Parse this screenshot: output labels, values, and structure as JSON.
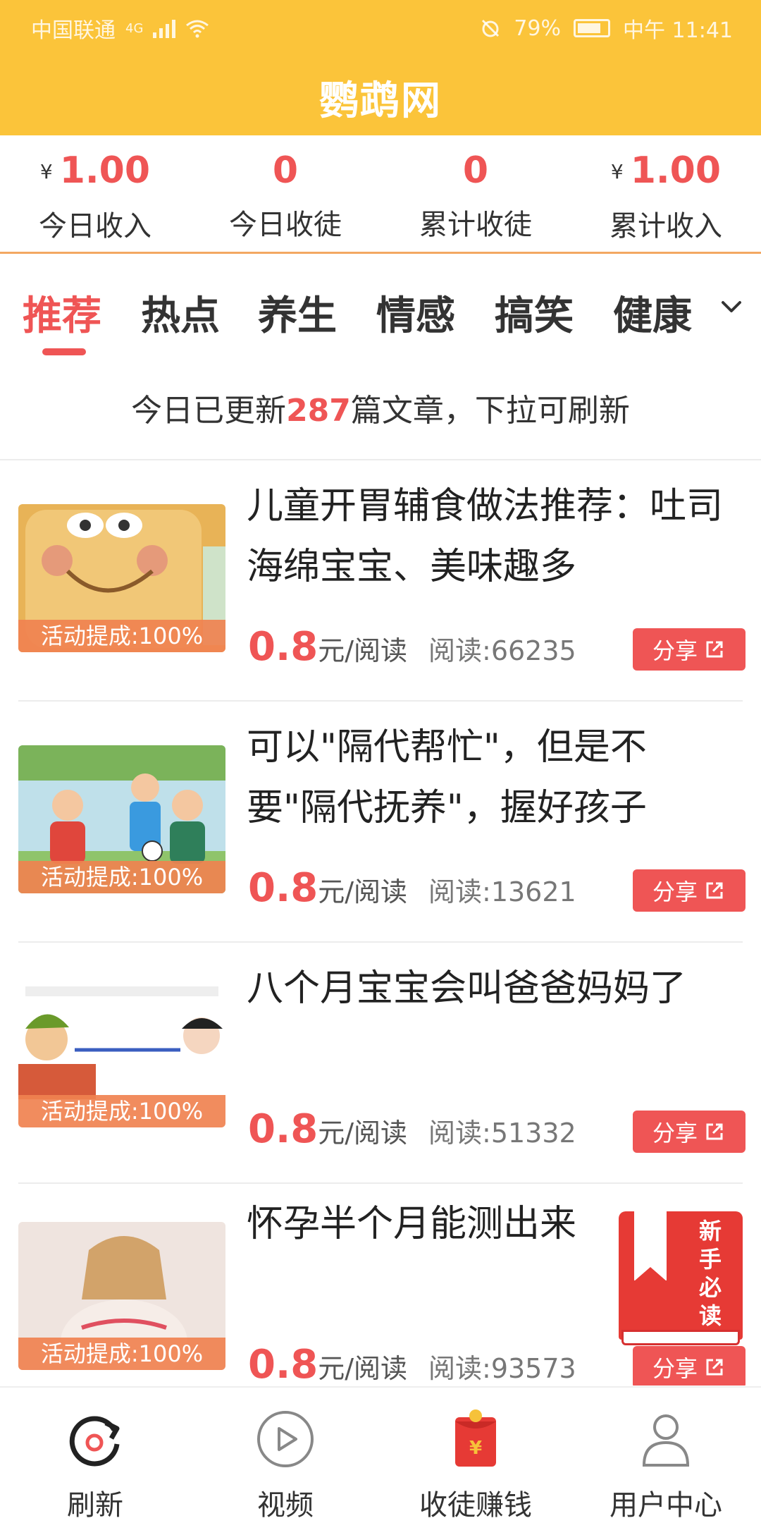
{
  "status_bar": {
    "carrier": "中国联通",
    "network": "4G",
    "battery": "79%",
    "time": "中午 11:41"
  },
  "app": {
    "title": "鹦鹉网"
  },
  "stats": [
    {
      "currency": "¥",
      "value": "1.00",
      "label": "今日收入"
    },
    {
      "currency": "",
      "value": "0",
      "label": "今日收徒"
    },
    {
      "currency": "",
      "value": "0",
      "label": "累计收徒"
    },
    {
      "currency": "¥",
      "value": "1.00",
      "label": "累计收入"
    }
  ],
  "tabs": [
    {
      "label": "推荐",
      "active": true
    },
    {
      "label": "热点",
      "active": false
    },
    {
      "label": "养生",
      "active": false
    },
    {
      "label": "情感",
      "active": false
    },
    {
      "label": "搞笑",
      "active": false
    },
    {
      "label": "健康",
      "active": false
    }
  ],
  "notice": {
    "prefix": "今日已更新",
    "count": "287",
    "suffix": "篇文章，下拉可刷新"
  },
  "articles": [
    {
      "title": "儿童开胃辅食做法推荐：吐司海绵宝宝、美味趣多",
      "badge": "活动提成:100%",
      "price": "0.8",
      "price_unit": "元/阅读",
      "reads": "阅读:66235",
      "share": "分享"
    },
    {
      "title": "可以\"隔代帮忙\"，但是不要\"隔代抚养\"，握好孩子",
      "badge": "活动提成:100%",
      "price": "0.8",
      "price_unit": "元/阅读",
      "reads": "阅读:13621",
      "share": "分享"
    },
    {
      "title": "八个月宝宝会叫爸爸妈妈了",
      "badge": "活动提成:100%",
      "price": "0.8",
      "price_unit": "元/阅读",
      "reads": "阅读:51332",
      "share": "分享"
    },
    {
      "title": "怀孕半个月能测出来",
      "badge": "活动提成:100%",
      "price": "0.8",
      "price_unit": "元/阅读",
      "reads": "阅读:93573",
      "share": "分享"
    }
  ],
  "guide_badge": {
    "text": "新手必读"
  },
  "bottom_nav": [
    {
      "label": "刷新",
      "icon": "refresh-icon"
    },
    {
      "label": "视频",
      "icon": "play-icon"
    },
    {
      "label": "收徒赚钱",
      "icon": "red-envelope-icon"
    },
    {
      "label": "用户中心",
      "icon": "user-icon"
    }
  ],
  "colors": {
    "header": "#fbc43a",
    "accent": "#ef5555",
    "badge": "#f08250"
  }
}
